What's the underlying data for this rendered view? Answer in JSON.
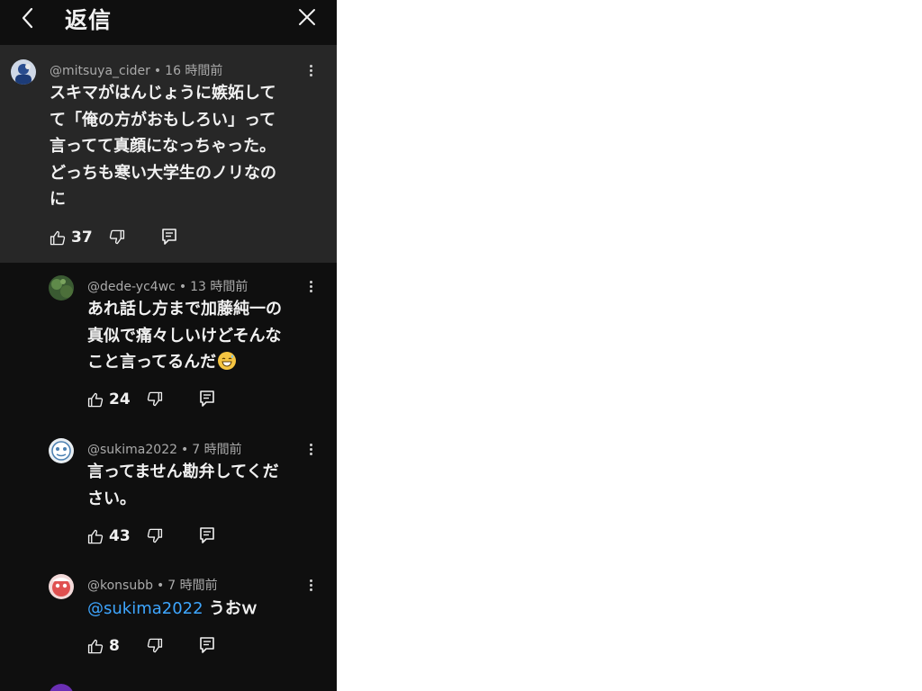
{
  "header": {
    "title": "返信"
  },
  "comments": [
    {
      "author": "@mitsuya_cider",
      "time": "16 時間前",
      "lines": [
        "スキマがはんじょうに嫉妬して",
        "て「俺の方がおもしろい」って",
        "言ってて真顔になっちゃった。",
        "どっちも寒い大学生のノリなの",
        "に"
      ],
      "likes": "37"
    },
    {
      "author": "@dede-yc4wc",
      "time": "13 時間前",
      "lines": [
        "あれ話し方まで加藤純一の",
        "真似で痛々しいけどそんな",
        "こと言ってるんだ"
      ],
      "emoji": "grinning-sweat-emoji",
      "likes": "24"
    },
    {
      "author": "@sukima2022",
      "time": "7 時間前",
      "lines": [
        "言ってません勘弁してくだ",
        "さい。"
      ],
      "likes": "43"
    },
    {
      "author": "@konsubb",
      "time": "7 時間前",
      "mention": "@sukima2022",
      "text_after_mention": " うおｗ",
      "likes": "8"
    }
  ],
  "colors": {
    "panel_bg": "#0f0f0f",
    "highlight_bg": "#272727",
    "meta": "#aaaaaa",
    "mention": "#3ea6ff"
  },
  "icons": [
    "back-icon",
    "close-icon",
    "thumbs-up-icon",
    "thumbs-down-icon",
    "reply-icon",
    "more-vert-icon"
  ]
}
